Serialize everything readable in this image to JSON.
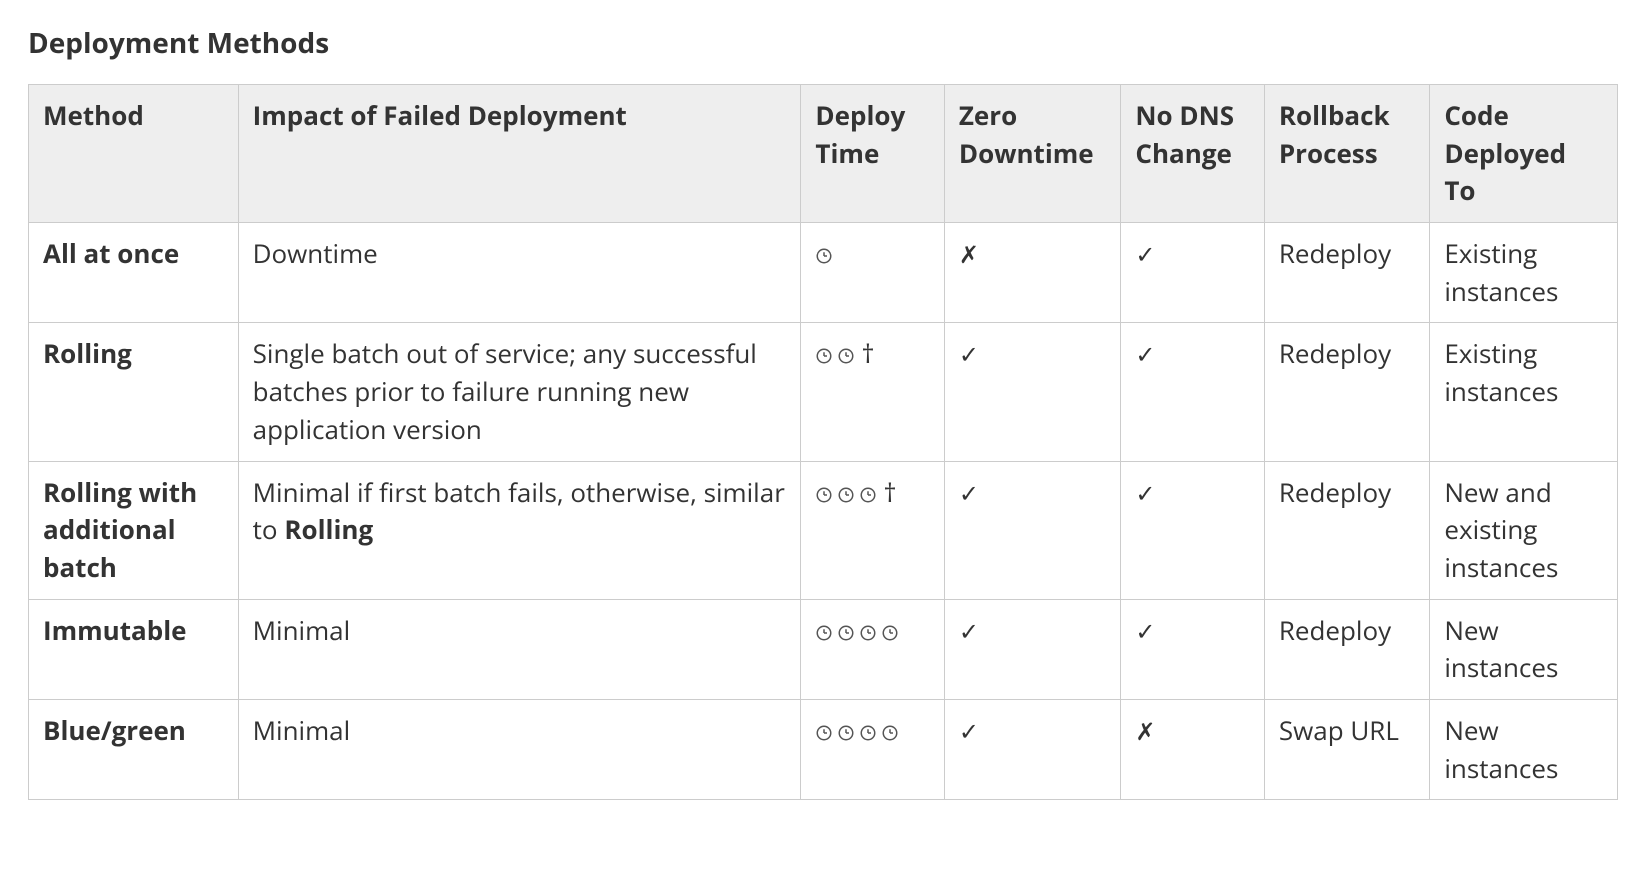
{
  "title": "Deployment Methods",
  "headers": {
    "method": "Method",
    "impact": "Impact of Failed Deployment",
    "deploy_time": "Deploy Time",
    "zero_downtime": "Zero Downtime",
    "no_dns_change": "No DNS Change",
    "rollback": "Rollback Process",
    "code_to": "Code Deployed To"
  },
  "symbols": {
    "check": "✓",
    "cross": "✗",
    "dagger": "†"
  },
  "rows": [
    {
      "method": "All at once",
      "impact": "Downtime",
      "impact_bold_suffix": "",
      "deploy_time_clocks": 1,
      "deploy_time_dagger": false,
      "zero_downtime": false,
      "no_dns_change": true,
      "rollback": "Redeploy",
      "code_to": "Existing instances"
    },
    {
      "method": "Rolling",
      "impact": "Single batch out of service; any successful batches prior to failure running new application version",
      "impact_bold_suffix": "",
      "deploy_time_clocks": 2,
      "deploy_time_dagger": true,
      "zero_downtime": true,
      "no_dns_change": true,
      "rollback": "Redeploy",
      "code_to": "Existing instances"
    },
    {
      "method": "Rolling with additional batch",
      "impact": "Minimal if first batch fails, otherwise, similar to ",
      "impact_bold_suffix": "Rolling",
      "deploy_time_clocks": 3,
      "deploy_time_dagger": true,
      "zero_downtime": true,
      "no_dns_change": true,
      "rollback": "Redeploy",
      "code_to": "New and existing instances"
    },
    {
      "method": "Immutable",
      "impact": "Minimal",
      "impact_bold_suffix": "",
      "deploy_time_clocks": 4,
      "deploy_time_dagger": false,
      "zero_downtime": true,
      "no_dns_change": true,
      "rollback": "Redeploy",
      "code_to": "New instances"
    },
    {
      "method": "Blue/green",
      "impact": "Minimal",
      "impact_bold_suffix": "",
      "deploy_time_clocks": 4,
      "deploy_time_dagger": false,
      "zero_downtime": true,
      "no_dns_change": false,
      "rollback": "Swap URL",
      "code_to": "New instances"
    }
  ],
  "chart_data": {
    "type": "table",
    "title": "Deployment Methods",
    "columns": [
      "Method",
      "Impact of Failed Deployment",
      "Deploy Time (relative, clock icons)",
      "Deploy Time dagger note",
      "Zero Downtime",
      "No DNS Change",
      "Rollback Process",
      "Code Deployed To"
    ],
    "rows": [
      [
        "All at once",
        "Downtime",
        1,
        false,
        false,
        true,
        "Redeploy",
        "Existing instances"
      ],
      [
        "Rolling",
        "Single batch out of service; any successful batches prior to failure running new application version",
        2,
        true,
        true,
        true,
        "Redeploy",
        "Existing instances"
      ],
      [
        "Rolling with additional batch",
        "Minimal if first batch fails, otherwise, similar to Rolling",
        3,
        true,
        true,
        true,
        "Redeploy",
        "New and existing instances"
      ],
      [
        "Immutable",
        "Minimal",
        4,
        false,
        true,
        true,
        "Redeploy",
        "New instances"
      ],
      [
        "Blue/green",
        "Minimal",
        4,
        false,
        true,
        false,
        "Swap URL",
        "New instances"
      ]
    ]
  }
}
